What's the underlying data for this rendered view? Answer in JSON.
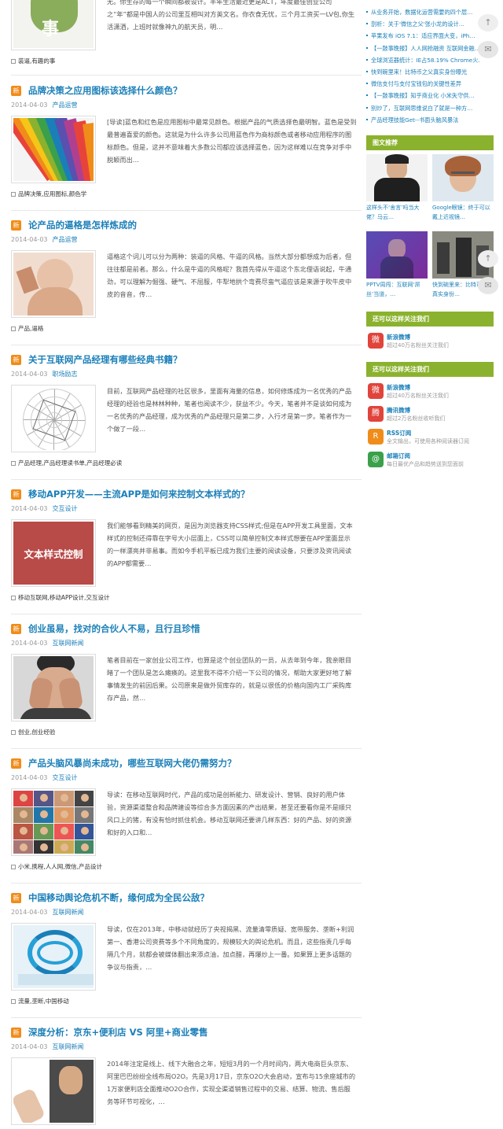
{
  "top_article": {
    "excerpt": "无。你生存的每一个瞬间都被设计。半年生活最近更是ACT，年度最佳创业公司之“年”都是中国人的公司里互相叫对方英文名。你衣食无忧，三个月工资买一LV包,你生活潇洒，上班时就像神九的航天员，明…",
    "tags": "装逼,有趣的事",
    "thumb_text": "事"
  },
  "articles": [
    {
      "badge": "新",
      "title": "品牌决策之应用图标该选择什么颜色？",
      "date": "2014-04-03",
      "category": "产品运营",
      "excerpt": "[导读]蓝色和红色是应用图标中最常见颜色。根据产品的气质选择色最明智。蓝色是受到最普遍喜爱的颜色。这就是为什么许多公司用蓝色作为商标颜色或者移动应用程序的图标颜色。但是，这并不意味着大多数公司都应该选择蓝色，因为这样难以在竞争对手中脱颖而出…",
      "tags": "品牌决策,应用图标,颜色学",
      "thumb_style": "swatches"
    },
    {
      "badge": "新",
      "title": "论产品的逼格是怎样炼成的",
      "date": "2014-04-03",
      "category": "产品运营",
      "excerpt": "逼格这个词儿可以分为两种：装逼的风格、牛逼的风格。当然大部分都想成为后者，但往往都是前者。那么，什么是牛逼的风格呢？我首先得从牛逼这个东北俚语说起，牛通劲，可以理解为倔强、硬气、不屈服，牛犁地拱个弯费尽蛮气逼应该是来源于吹牛皮中皮的音音，传…",
      "tags": "产品,逼格",
      "thumb_style": "baby"
    },
    {
      "badge": "新",
      "title": "关于互联网产品经理有哪些经典书籍？",
      "date": "2014-04-03",
      "category": "职场励志",
      "excerpt": "目前，互联网产品经理的社区很多，里面有海量的信息，如何修炼成为一名优秀的产品经理的经验也是林林种种，笔者也阅读不少，获益不少。今天，笔者并不是谈如何成为一名优秀的产品经理，成为优秀的产品经理只是第二步，入行才是第一步。笔者作为一个做了一段…",
      "tags": "产品经理,产品经理读书单,产品经理必读",
      "thumb_style": "radar"
    },
    {
      "badge": "新",
      "title": "移动APP开发——主流APP是如何来控制文本样式的？",
      "date": "2014-04-03",
      "category": "交互设计",
      "excerpt": "我们能够看到精美的网页，是因为浏览器支持CSS样式;但是在APP开发工具里面，文本样式的控制还得靠在字号大小层面上，CSS可以简单控制文本样式想要在APP里面显示的一样漂亮并非易事。而如今手机平板已成为我们主要的阅读设备，只要涉及资讯阅读的APP都需要…",
      "tags": "移动互联网,移动APP设计,交互设计",
      "thumb_style": "textstyle",
      "thumb_text": "文本样式控制"
    },
    {
      "badge": "新",
      "title": "创业虽易，找对的合伙人不易，且行且珍惜",
      "date": "2014-04-03",
      "category": "互联网新闻",
      "excerpt": "笔者目前在一家创业公司工作，也算是这个创业团队的一员，从去年到今年，我亲眼目睹了一个团队是怎么瘫痪的。这里我不得不介绍一下公司的情况，帮助大家更好地了解事情发生的前因后果。公司原来是做外贸库存的，就是以很低的价格向国内工厂采购库存产品，然…",
      "tags": "创业,创业经验",
      "thumb_style": "face"
    },
    {
      "badge": "新",
      "title": "产品头脑风暴尚未成功，哪些互联网大佬仍需努力？",
      "date": "2014-04-03",
      "category": "交互设计",
      "excerpt": "导读：在移动互联网时代，产品的成功是创新能力、研发设计、营销、良好的用户体验，资源渠道整合和品牌建设等综合多方面因素的产出结果，甚至还要看你是不是顺只风口上的猪，有没有恰时抓住机会。移动互联网还要讲几样东西：好的产品、好的资源和好的入口和…",
      "tags": "小米,携程,人人网,微信,产品设计",
      "thumb_style": "collage"
    },
    {
      "badge": "新",
      "title": "中国移动舆论危机不断，缘何成为全民公敌？",
      "date": "2014-04-03",
      "category": "互联网新闻",
      "excerpt": "导读，仅在2013年，中移动就经历了央视揭黑、流量清零质疑、宽带服务、垄断+利润第一、香港公司资费等多个不同角度的，规模较大的舆论危机。而且，这些指责几乎每隔几个月，就都会被媒体翻出来添点油，加点醋，再爆炒上一番。如果算上更多话题的争议与指责，…",
      "tags": "流量,垄断,中国移动",
      "thumb_style": "mobile"
    },
    {
      "badge": "新",
      "title": "深度分析：京东+便利店 VS 阿里+商业零售",
      "date": "2014-04-03",
      "category": "互联网新闻",
      "excerpt": "2014年注定是线上、线下大融合之年，短短3月的一个月时间内，两大电商巨头京东、阿里巴巴纷纷全线布局O2O。先是3月17日，京东O2O大会启动，宣布与15余座城市的1万家便利店全面推动O2O合作，实现全渠道销售过程中的交易、结算、物流、售后服务等环节可视化，…",
      "tags": "",
      "thumb_style": "jack"
    }
  ],
  "sidebar": {
    "hot_list": [
      "从业务开始，数据化运营需要的四个层…",
      "剖析：关于'微信之父'张小龙的设计…",
      "苹果发布 iOS 7.1：适应界面大变，iPh…",
      "【一鼓事晚报】人人网抢融资 互联网金融…",
      "全球浏览器统计：IE占58.19% Chrome火…",
      "快到碗里来！比特币之父真实身份曝光",
      "微信支付与支付宝钱包的关键性差异",
      "【一鼓事晚报】知乎商业化 小米失守供…",
      "别炒了，互联网思维说白了就是一种方…",
      "产品经理技能Get--书面头脑风暴法"
    ],
    "pic_header": "图文推荐",
    "pics": [
      {
        "caption": "这样头不‘舍言’吗当大佬？马云…",
        "style": "suit"
      },
      {
        "caption": "Google眼镜：终于可以戴上近视镜…",
        "style": "glasses"
      },
      {
        "caption": "PPTV周闯：互联网‘屌丝’当道，…",
        "style": "stage"
      },
      {
        "caption": "快到碗里来：比特币之父真实身份…",
        "style": "street"
      }
    ],
    "follow_header_1": "还可以这样关注我们",
    "follow_header_2": "还可以这样关注我们",
    "follow_1": [
      {
        "name": "新浪微博",
        "desc": "超过40万名粉丝关注我们",
        "icon": "weibo-icon",
        "color": "#e0443b",
        "glyph": "微"
      }
    ],
    "follow_2": [
      {
        "name": "新浪微博",
        "desc": "超过40万名粉丝关注我们",
        "icon": "weibo-icon",
        "color": "#e0443b",
        "glyph": "微"
      },
      {
        "name": "腾讯微博",
        "desc": "超过2万名粉丝收听我们",
        "icon": "tencent-weibo-icon",
        "color": "#e0443b",
        "glyph": "腾"
      },
      {
        "name": "RSS订阅",
        "desc": "全文输出，可使用各种阅读器订阅",
        "icon": "rss-icon",
        "color": "#f08c1a",
        "glyph": "R"
      },
      {
        "name": "邮箱订阅",
        "desc": "每日最优产品和趋势送到您面前",
        "icon": "mail-icon",
        "color": "#3aa04b",
        "glyph": "@"
      }
    ]
  },
  "floating": {
    "rocket": "↑",
    "wechat": "✉"
  }
}
